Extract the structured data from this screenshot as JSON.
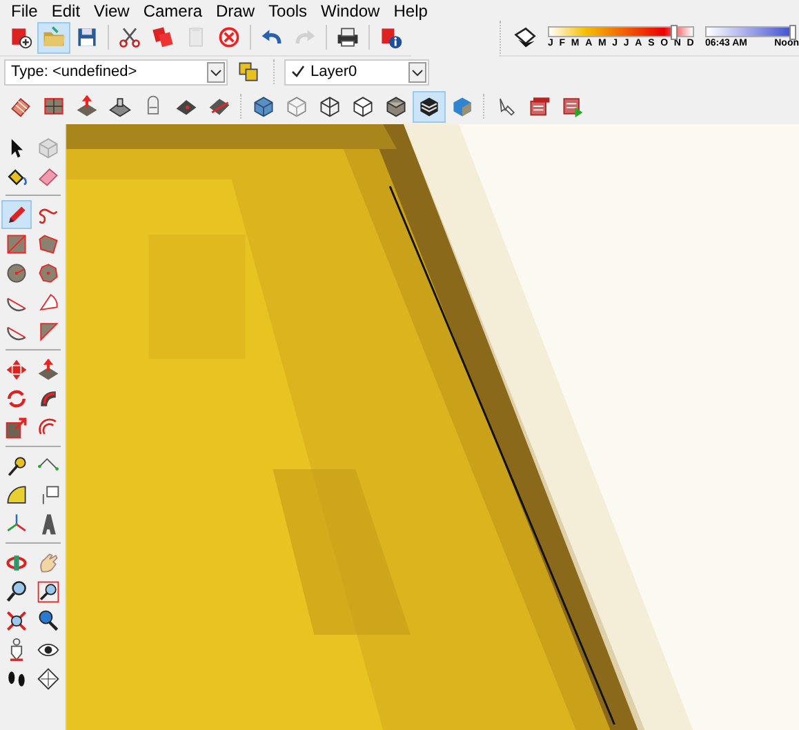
{
  "menu": [
    "File",
    "Edit",
    "View",
    "Camera",
    "Draw",
    "Tools",
    "Window",
    "Help"
  ],
  "main_toolbar": [
    {
      "selected": false,
      "disabled": false
    },
    {
      "selected": true,
      "disabled": false
    },
    {
      "selected": false,
      "disabled": false
    },
    {
      "selected": false,
      "disabled": false
    },
    {
      "selected": false,
      "disabled": false
    },
    {
      "selected": false,
      "disabled": true
    },
    {
      "selected": false,
      "disabled": false
    },
    {
      "selected": false,
      "disabled": false
    },
    {
      "selected": false,
      "disabled": true
    },
    {
      "selected": false,
      "disabled": false
    },
    {
      "selected": false,
      "disabled": false
    }
  ],
  "shadows": {
    "months": [
      "J",
      "F",
      "M",
      "A",
      "M",
      "J",
      "J",
      "A",
      "S",
      "O",
      "N",
      "D"
    ],
    "month_slider": {
      "level": 0.87
    },
    "time_slider": {
      "level": 0.97
    },
    "time": "06:43 AM",
    "noon": "Noon"
  },
  "entity_type": {
    "value": "Type: <undefined>"
  },
  "layer": {
    "value": "Layer0"
  },
  "views_toolbar": [
    {
      "selected": false
    },
    {
      "selected": false
    },
    {
      "selected": false
    },
    {
      "selected": false
    },
    {
      "selected": false
    },
    {
      "selected": false
    },
    {
      "selected": false
    },
    {
      "selected": false
    },
    {
      "selected": false
    },
    {
      "selected": false
    },
    {
      "selected": false
    },
    {
      "selected": false
    },
    {
      "selected": true
    },
    {
      "selected": false
    },
    {
      "selected": false
    },
    {
      "selected": false
    },
    {
      "selected": false
    }
  ],
  "tools": [
    {
      "selected": false
    },
    {
      "selected": false
    },
    {
      "selected": false
    },
    {
      "selected": false
    },
    {
      "selected": true
    },
    {
      "selected": false
    },
    {
      "selected": false
    },
    {
      "selected": false
    },
    {
      "selected": false
    },
    {
      "selected": false
    },
    {
      "selected": false
    },
    {
      "selected": false
    },
    {
      "selected": false
    },
    {
      "selected": false
    },
    {
      "selected": false
    },
    {
      "selected": false
    },
    {
      "selected": false
    },
    {
      "selected": false
    },
    {
      "selected": false
    },
    {
      "selected": false
    },
    {
      "selected": false
    },
    {
      "selected": false
    },
    {
      "selected": false
    },
    {
      "selected": false
    },
    {
      "selected": false
    },
    {
      "selected": false
    },
    {
      "selected": false
    },
    {
      "selected": false
    },
    {
      "selected": false
    },
    {
      "selected": false
    },
    {
      "selected": false
    },
    {
      "selected": false
    },
    {
      "selected": false
    },
    {
      "selected": false
    },
    {
      "selected": false
    },
    {
      "selected": false
    }
  ]
}
